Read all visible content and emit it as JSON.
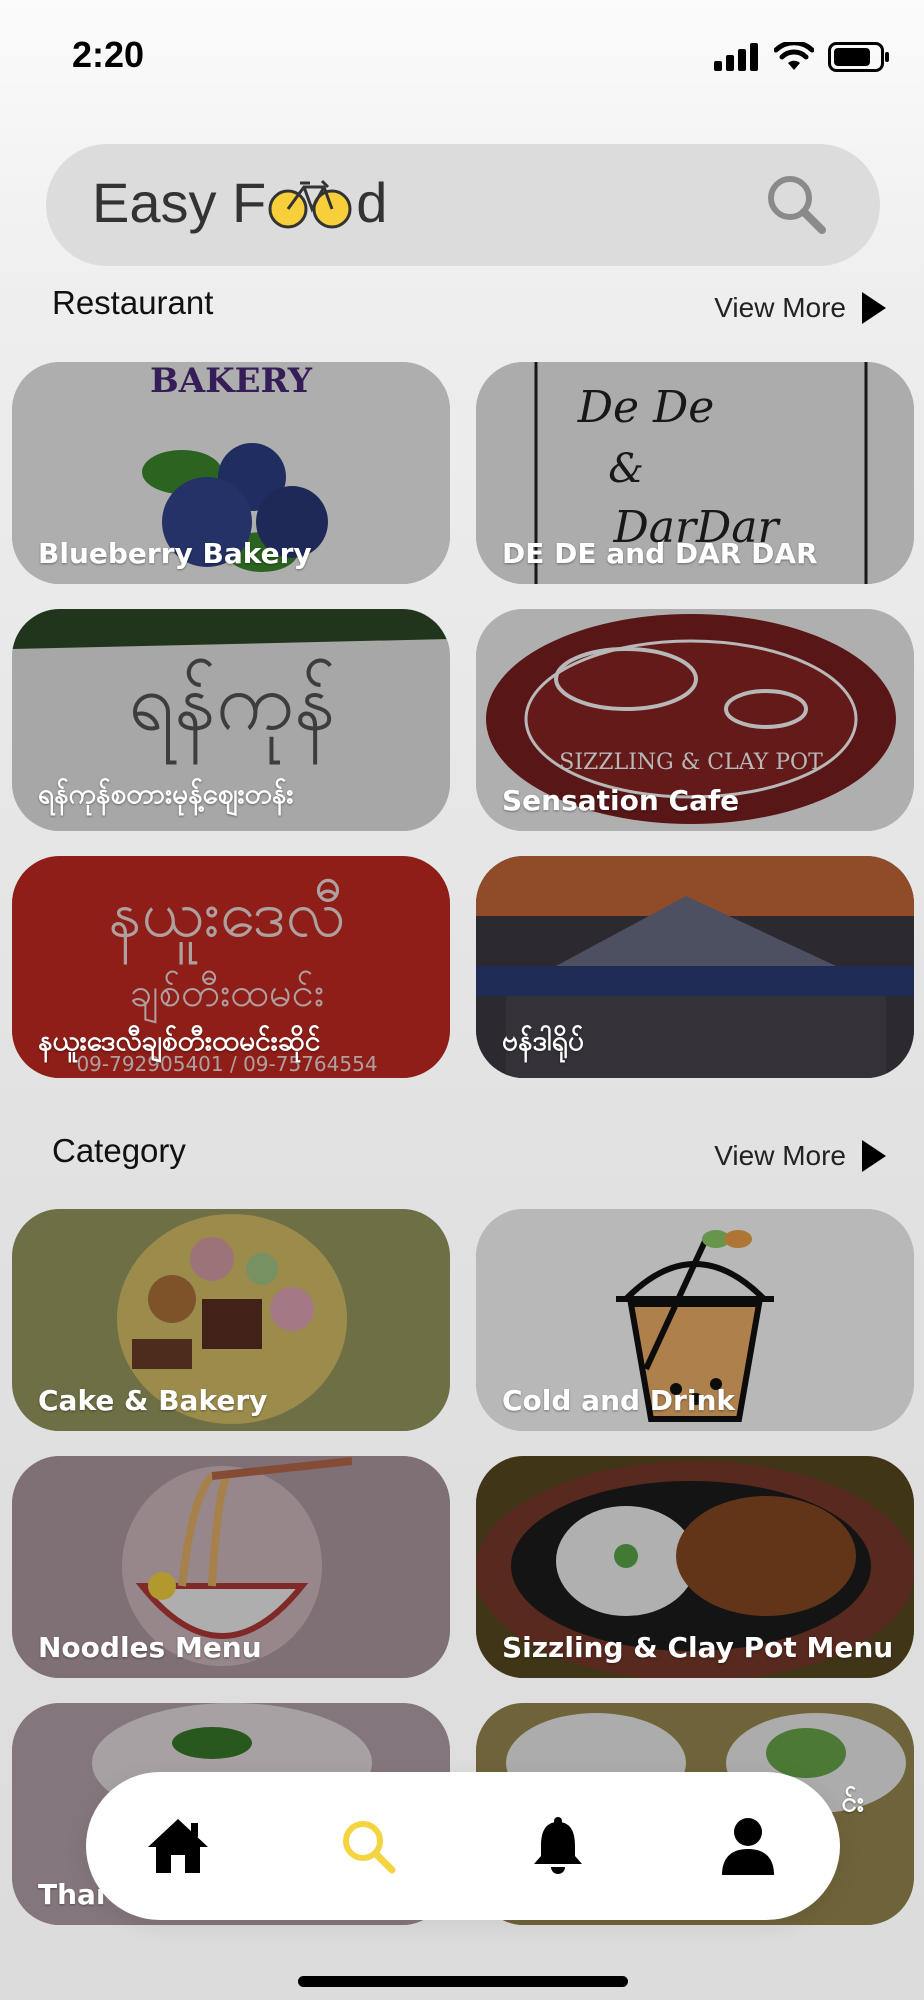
{
  "status_bar": {
    "time": "2:20"
  },
  "search": {
    "logo_prefix": "Easy F",
    "logo_suffix": "d"
  },
  "restaurant_section": {
    "title": "Restaurant",
    "view_more": "View More",
    "items": [
      {
        "label": "Blueberry Bakery"
      },
      {
        "label": "DE DE and DAR DAR"
      },
      {
        "label": "ရန်ကုန်စတားမုန့်ဈေးတန်း"
      },
      {
        "label": "Sensation Cafe"
      },
      {
        "label": "နယူးဒေလီချစ်တီးထမင်းဆိုင်"
      },
      {
        "label": "ဗန်ဒါရိုပ်"
      }
    ]
  },
  "category_section": {
    "title": "Category",
    "view_more": "View More",
    "items": [
      {
        "label": "Cake & Bakery"
      },
      {
        "label": "Cold and Drink"
      },
      {
        "label": "Noodles Menu"
      },
      {
        "label": "Sizzling & Clay Pot Menu"
      },
      {
        "label": "Thai"
      },
      {
        "label": "င်း"
      }
    ]
  },
  "tab_bar": {
    "tabs": [
      {
        "icon": "home-icon",
        "active": false
      },
      {
        "icon": "search-icon",
        "active": true
      },
      {
        "icon": "bell-icon",
        "active": false
      },
      {
        "icon": "profile-icon",
        "active": false
      }
    ],
    "active_color": "#f5d442"
  },
  "colors": {
    "accent": "#f5d442",
    "logo_yellow": "#f6cf3a"
  }
}
